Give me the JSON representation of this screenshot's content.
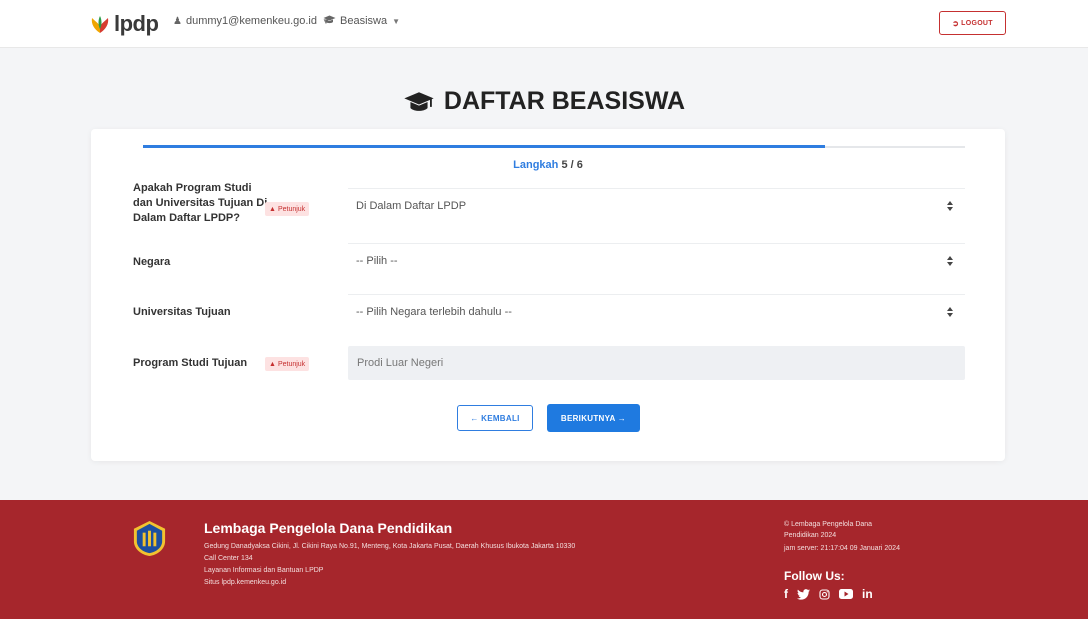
{
  "brand": {
    "name": "lpdp"
  },
  "nav": {
    "user_email": "dummy1@kemenkeu.go.id",
    "beasiswa_label": "Beasiswa",
    "logout_label": "LOGOUT"
  },
  "page": {
    "title": "DAFTAR BEASISWA"
  },
  "progress": {
    "step_word": "Langkah",
    "step_current_of_total": "5 / 6",
    "current": 5,
    "total": 6,
    "fraction": 0.83
  },
  "form": {
    "hint_label": "Petunjuk",
    "fields": [
      {
        "label": "Apakah Program Studi dan Universitas Tujuan Di Dalam Daftar LPDP?",
        "value": "Di Dalam Daftar LPDP"
      },
      {
        "label": "Negara",
        "value": "-- Pilih --"
      },
      {
        "label": "Universitas Tujuan",
        "value": "-- Pilih Negara terlebih dahulu --"
      },
      {
        "label": "Program Studi Tujuan",
        "value": "Prodi Luar Negeri"
      }
    ],
    "back_label": "← KEMBALI",
    "next_label": "BERIKUTNYA →"
  },
  "footer": {
    "org_name": "Lembaga Pengelola Dana Pendidikan",
    "address": "Gedung Danadyaksa Cikini, Jl. Cikini Raya No.91, Menteng, Kota Jakarta Pusat, Daerah Khusus Ibukota Jakarta 10330",
    "call_center": "Call Center 134",
    "service": "Layanan Informasi dan Bantuan LPDP",
    "site": "Situs lpdp.kemenkeu.go.id",
    "copyright_line1": "© Lembaga Pengelola Dana",
    "copyright_line2": "Pendidikan 2024",
    "server_time": "jam server: 21:17:04 09 Januari 2024",
    "follow_us": "Follow Us:",
    "social_icons": [
      "facebook-icon",
      "twitter-icon",
      "instagram-icon",
      "youtube-icon",
      "linkedin-icon"
    ]
  },
  "colors": {
    "accent": "#2f7de0",
    "danger": "#c53030",
    "footer_bg": "#a6262c"
  }
}
